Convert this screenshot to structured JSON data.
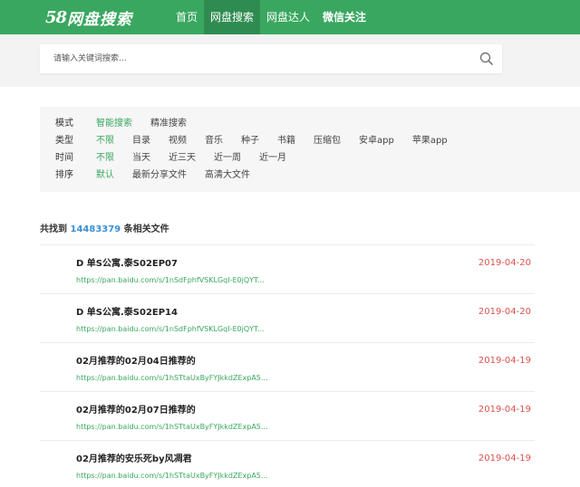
{
  "header": {
    "logo_num": "58",
    "logo_text": "网盘搜索",
    "nav": [
      {
        "label": "首页"
      },
      {
        "label": "网盘搜索"
      },
      {
        "label": "网盘达人"
      },
      {
        "label": "微信关注"
      }
    ]
  },
  "search": {
    "placeholder": "请输入关键词搜索..."
  },
  "filters": {
    "mode": {
      "label": "模式",
      "options": [
        "智能搜索",
        "精准搜索"
      ],
      "selected": "智能搜索"
    },
    "type": {
      "label": "类型",
      "options": [
        "不限",
        "目录",
        "视频",
        "音乐",
        "种子",
        "书籍",
        "压缩包",
        "安卓app",
        "苹果app"
      ],
      "selected": "不限"
    },
    "time": {
      "label": "时间",
      "options": [
        "不限",
        "当天",
        "近三天",
        "近一周",
        "近一月"
      ],
      "selected": "不限"
    },
    "sort": {
      "label": "排序",
      "options": [
        "默认",
        "最新分享文件",
        "高清大文件"
      ],
      "selected": "默认"
    }
  },
  "results_summary": {
    "prefix": "共找到",
    "count": "14483379",
    "suffix": "条相关文件"
  },
  "results": [
    {
      "title": "D 单S公寓.泰S02EP07",
      "link": "https://pan.baidu.com/s/1nSdFphfVSKLGqI-E0jQYT...",
      "date": "2019-04-20"
    },
    {
      "title": "D 单S公寓.泰S02EP14",
      "link": "https://pan.baidu.com/s/1nSdFphfVSKLGqI-E0jQYT...",
      "date": "2019-04-20"
    },
    {
      "title": "02月推荐的02月04日推荐的",
      "link": "https://pan.baidu.com/s/1hSTtaUxByFYJkkdZExpA5...",
      "date": "2019-04-19"
    },
    {
      "title": "02月推荐的02月07日推荐的",
      "link": "https://pan.baidu.com/s/1hSTtaUxByFYJkkdZExpA5...",
      "date": "2019-04-19"
    },
    {
      "title": "02月推荐的安乐死by风凋君",
      "link": "https://pan.baidu.com/s/1hSTtaUxByFYJkkdZExpA5...",
      "date": "2019-04-19"
    }
  ],
  "colors": {
    "brand_green": "#3aa760",
    "nav_active": "#2f8c50",
    "count_blue": "#3b8fd6",
    "date_red": "#d9534f"
  },
  "icons": {
    "search": "search-icon"
  }
}
